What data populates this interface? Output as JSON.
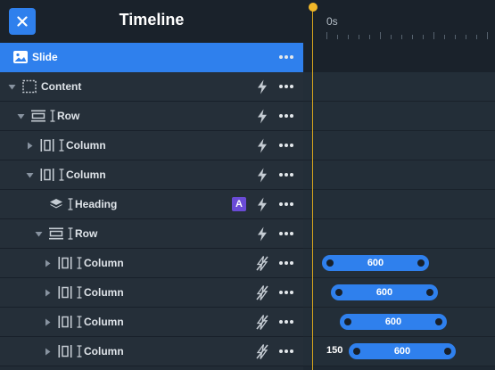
{
  "header": {
    "title": "Timeline",
    "close_icon": "close-icon"
  },
  "ruler": {
    "start_label": "0s"
  },
  "colors": {
    "accent": "#2f80ed",
    "playhead": "#f2b829",
    "badge": "#6a4bd6"
  },
  "layers": [
    {
      "label": "Slide",
      "icon": "image-icon",
      "selected": true,
      "caret": null,
      "resize": false,
      "badge": null,
      "bolt": false,
      "dots": true
    },
    {
      "label": "Content",
      "icon": "dashed-frame-icon",
      "caret": "down",
      "resize": false,
      "badge": null,
      "bolt": "solid",
      "dots": true
    },
    {
      "label": "Row",
      "icon": "row-icon",
      "caret": "down",
      "resize": true,
      "badge": null,
      "bolt": "solid",
      "dots": true
    },
    {
      "label": "Column",
      "icon": "column-icon",
      "caret": "right",
      "resize": true,
      "badge": null,
      "bolt": "solid",
      "dots": true
    },
    {
      "label": "Column",
      "icon": "column-icon",
      "caret": "down",
      "resize": true,
      "badge": null,
      "bolt": "solid",
      "dots": true
    },
    {
      "label": "Heading",
      "icon": "layers-icon",
      "caret": null,
      "resize": true,
      "badge": "A",
      "bolt": "solid",
      "dots": true
    },
    {
      "label": "Row",
      "icon": "row-icon",
      "caret": "down",
      "resize": true,
      "badge": null,
      "bolt": "solid",
      "dots": true
    },
    {
      "label": "Column",
      "icon": "column-icon",
      "caret": "right",
      "resize": true,
      "badge": null,
      "bolt": "slashed",
      "dots": true
    },
    {
      "label": "Column",
      "icon": "column-icon",
      "caret": "right",
      "resize": true,
      "badge": null,
      "bolt": "slashed",
      "dots": true
    },
    {
      "label": "Column",
      "icon": "column-icon",
      "caret": "right",
      "resize": true,
      "badge": null,
      "bolt": "slashed",
      "dots": true
    },
    {
      "label": "Column",
      "icon": "column-icon",
      "caret": "right",
      "resize": true,
      "badge": null,
      "bolt": "slashed",
      "dots": true
    }
  ],
  "timeline_bars": [
    {
      "row": 7,
      "duration": "600",
      "delay": null
    },
    {
      "row": 8,
      "duration": "600",
      "delay": null
    },
    {
      "row": 9,
      "duration": "600",
      "delay": null
    },
    {
      "row": 10,
      "duration": "600",
      "delay": "150"
    }
  ]
}
